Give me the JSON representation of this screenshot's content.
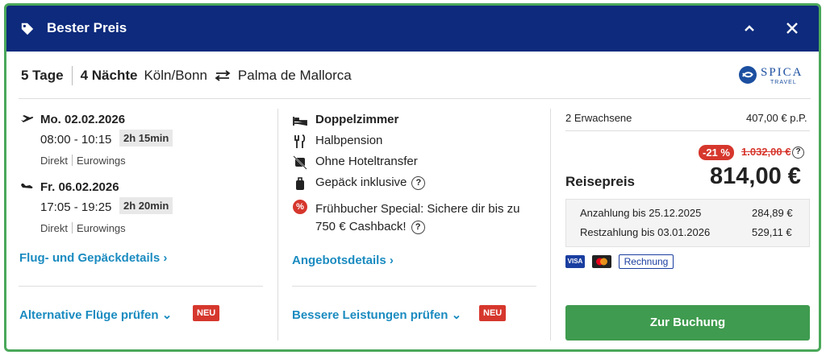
{
  "header": {
    "title": "Bester Preis"
  },
  "trip": {
    "days": "5 Tage",
    "nights": "4 Nächte",
    "origin": "Köln/Bonn",
    "destination": "Palma de Mallorca",
    "operator": "SPICA",
    "operator_sub": "TRAVEL"
  },
  "outbound": {
    "date": "Mo. 02.02.2026",
    "time": "08:00 - 10:15",
    "duration": "2h 15min",
    "type": "Direkt",
    "airline": "Eurowings"
  },
  "return": {
    "date": "Fr. 06.02.2026",
    "time": "17:05 - 19:25",
    "duration": "2h 20min",
    "type": "Direkt",
    "airline": "Eurowings"
  },
  "links": {
    "flight_details": "Flug- und Gepäckdetails",
    "alt_flights": "Alternative Flüge prüfen",
    "offer_details": "Angebotsdetails",
    "better_services": "Bessere Leistungen prüfen",
    "neu": "NEU"
  },
  "hotel": {
    "room": "Doppelzimmer",
    "board": "Halbpension",
    "transfer": "Ohne Hoteltransfer",
    "luggage": "Gepäck inklusive",
    "special_line1": "Frühbucher Special: Sichere dir bis zu",
    "special_line2": "750 € Cashback!"
  },
  "price": {
    "travellers": "2 Erwachsene",
    "per_person": "407,00 € p.P.",
    "discount": "-21 %",
    "old_price": "1.032,00 €",
    "label": "Reisepreis",
    "total": "814,00 €",
    "deposit_label": "Anzahlung bis 25.12.2025",
    "deposit_value": "284,89 €",
    "rest_label": "Restzahlung bis 03.01.2026",
    "rest_value": "529,11 €",
    "invoice": "Rechnung",
    "visa": "VISA",
    "book": "Zur Buchung"
  },
  "colors": {
    "header": "#0d2a7c",
    "link": "#1a8bc0",
    "accent_red": "#d6372d",
    "button": "#3f9b4f",
    "border": "#4aa85a"
  }
}
